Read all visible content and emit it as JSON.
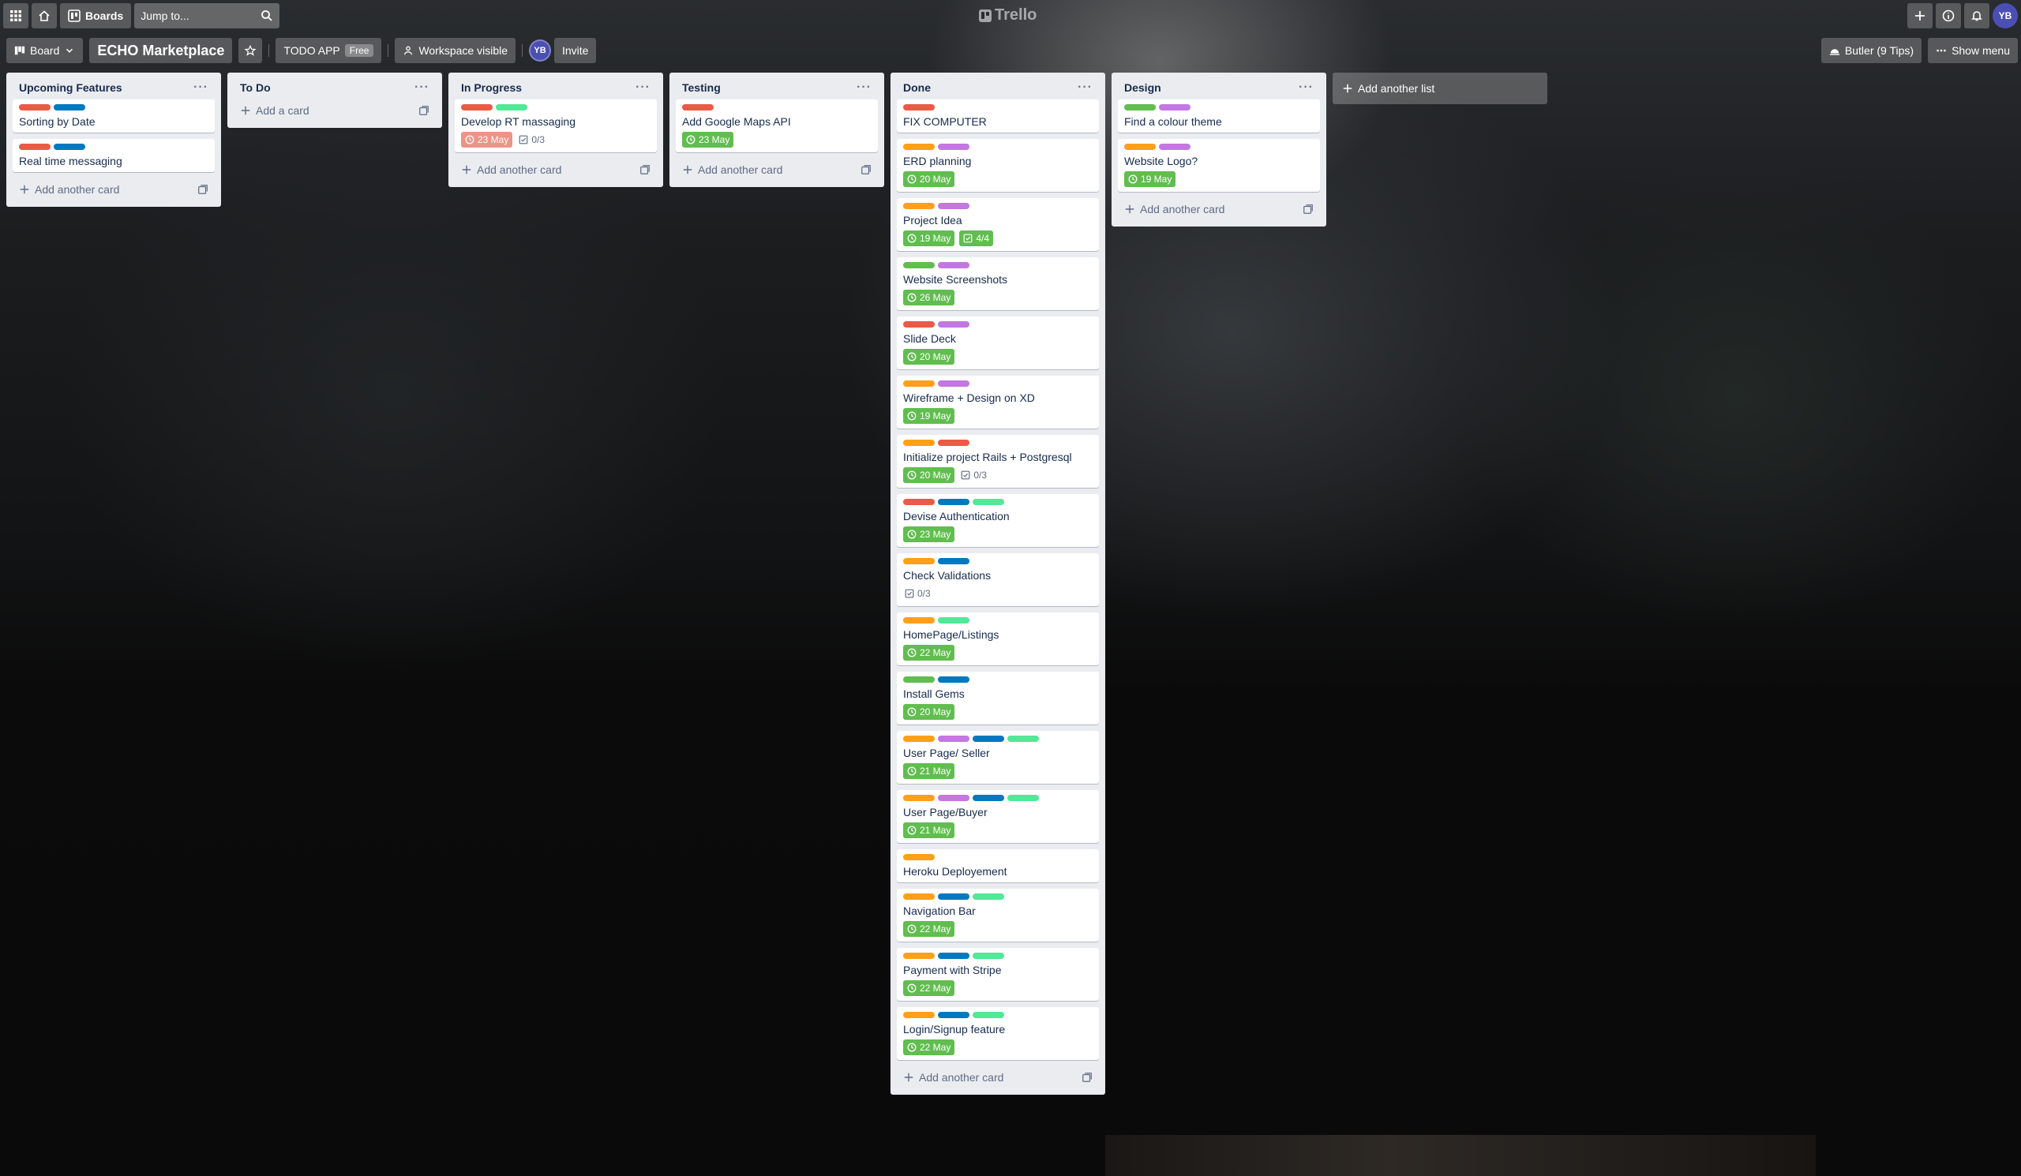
{
  "colors": {
    "red": "#eb5a46",
    "blue": "#0079bf",
    "green_label": "#61bd4f",
    "mint": "#51e898",
    "orange": "#ff9f1a",
    "purple": "#c377e0",
    "due_green": "#61bd4f",
    "due_red": "#ec9488"
  },
  "header": {
    "boards_label": "Boards",
    "search_placeholder": "Jump to...",
    "logo": "Trello",
    "avatar": "YB"
  },
  "board": {
    "view_label": "Board",
    "title": "ECHO Marketplace",
    "workspace_name": "TODO APP",
    "workspace_plan": "Free",
    "visibility": "Workspace visible",
    "member_avatar": "YB",
    "invite_label": "Invite",
    "butler_label": "Butler (9 Tips)",
    "show_menu_label": "Show menu",
    "add_list_label": "Add another list"
  },
  "lists": [
    {
      "title": "Upcoming Features",
      "add_label": "Add another card",
      "cards": [
        {
          "title": "Sorting by Date",
          "labels": [
            "red",
            "blue"
          ]
        },
        {
          "title": "Real time messaging",
          "labels": [
            "red",
            "blue"
          ]
        }
      ]
    },
    {
      "title": "To Do",
      "add_label": "Add a card",
      "cards": []
    },
    {
      "title": "In Progress",
      "add_label": "Add another card",
      "cards": [
        {
          "title": "Develop RT massaging",
          "labels": [
            "red",
            "mint"
          ],
          "due": "23 May",
          "due_status": "overdue",
          "checklist": "0/3"
        }
      ]
    },
    {
      "title": "Testing",
      "add_label": "Add another card",
      "cards": [
        {
          "title": "Add Google Maps API",
          "labels": [
            "red"
          ],
          "due": "23 May",
          "due_status": "complete"
        }
      ]
    },
    {
      "title": "Done",
      "add_label": "Add another card",
      "cards": [
        {
          "title": "FIX COMPUTER",
          "labels": [
            "red"
          ]
        },
        {
          "title": "ERD planning",
          "labels": [
            "orange",
            "purple"
          ],
          "due": "20 May",
          "due_status": "complete"
        },
        {
          "title": "Project Idea",
          "labels": [
            "orange",
            "purple"
          ],
          "due": "19 May",
          "due_status": "complete",
          "checklist": "4/4",
          "checklist_done": true
        },
        {
          "title": "Website Screenshots",
          "labels": [
            "green_label",
            "purple"
          ],
          "due": "26 May",
          "due_status": "complete"
        },
        {
          "title": "Slide Deck",
          "labels": [
            "red",
            "purple"
          ],
          "due": "20 May",
          "due_status": "complete"
        },
        {
          "title": "Wireframe + Design on XD",
          "labels": [
            "orange",
            "purple"
          ],
          "due": "19 May",
          "due_status": "complete"
        },
        {
          "title": "Initialize project Rails + Postgresql",
          "labels": [
            "orange",
            "red"
          ],
          "due": "20 May",
          "due_status": "complete",
          "checklist": "0/3"
        },
        {
          "title": "Devise Authentication",
          "labels": [
            "red",
            "blue",
            "mint"
          ],
          "due": "23 May",
          "due_status": "complete"
        },
        {
          "title": "Check Validations",
          "labels": [
            "orange",
            "blue"
          ],
          "checklist": "0/3"
        },
        {
          "title": "HomePage/Listings",
          "labels": [
            "orange",
            "mint"
          ],
          "due": "22 May",
          "due_status": "complete"
        },
        {
          "title": "Install Gems",
          "labels": [
            "green_label",
            "blue"
          ],
          "due": "20 May",
          "due_status": "complete"
        },
        {
          "title": "User Page/ Seller",
          "labels": [
            "orange",
            "purple",
            "blue",
            "mint"
          ],
          "due": "21 May",
          "due_status": "complete"
        },
        {
          "title": "User Page/Buyer",
          "labels": [
            "orange",
            "purple",
            "blue",
            "mint"
          ],
          "due": "21 May",
          "due_status": "complete"
        },
        {
          "title": "Heroku Deployement",
          "labels": [
            "orange"
          ]
        },
        {
          "title": "Navigation Bar",
          "labels": [
            "orange",
            "blue",
            "mint"
          ],
          "due": "22 May",
          "due_status": "complete"
        },
        {
          "title": "Payment with Stripe",
          "labels": [
            "orange",
            "blue",
            "mint"
          ],
          "due": "22 May",
          "due_status": "complete"
        },
        {
          "title": "Login/Signup feature",
          "labels": [
            "orange",
            "blue",
            "mint"
          ],
          "due": "22 May",
          "due_status": "complete"
        }
      ]
    },
    {
      "title": "Design",
      "add_label": "Add another card",
      "cards": [
        {
          "title": "Find a colour theme",
          "labels": [
            "green_label",
            "purple"
          ]
        },
        {
          "title": "Website Logo?",
          "labels": [
            "orange",
            "purple"
          ],
          "due": "19 May",
          "due_status": "complete"
        }
      ]
    }
  ]
}
